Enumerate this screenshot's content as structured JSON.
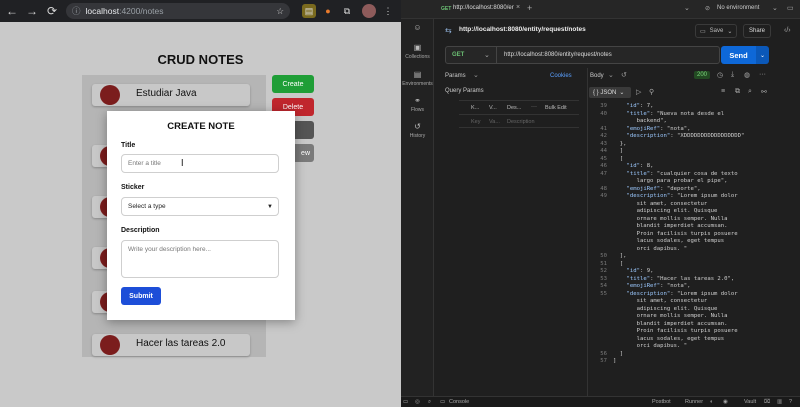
{
  "browser": {
    "url_host": "localhost",
    "url_rest": ":4200/notes"
  },
  "app": {
    "title": "CRUD NOTES",
    "notes": [
      "Estudiar Java",
      "Hacer las tareas 2.0"
    ],
    "side_buttons": [
      {
        "label": "Create",
        "color": "#1f9e37"
      },
      {
        "label": "Delete",
        "color": "#c0262d"
      },
      {
        "label": "",
        "color": "#555"
      },
      {
        "label": "ew",
        "color": "#7a7a7a"
      }
    ]
  },
  "modal": {
    "heading": "CREATE NOTE",
    "title_label": "Title",
    "title_placeholder": "Enter a title",
    "sticker_label": "Sticker",
    "sticker_value": "Select a type",
    "description_label": "Description",
    "description_placeholder": "Write your description here...",
    "submit_label": "Submit"
  },
  "postman": {
    "tab_method": "GET",
    "tab_title": "http://localhost:8080/er",
    "environment": "No environment",
    "request_title": "http://localhost:8080/entity/request/notes",
    "save_label": "Save",
    "share_label": "Share",
    "method": "GET",
    "url": "http://localhost:8080/entity/request/notes",
    "send_label": "Send",
    "rail": [
      "Collections",
      "Environments",
      "Flows",
      "History"
    ],
    "req_tabs": {
      "params": "Params",
      "cookies": "Cookies"
    },
    "query_params_label": "Query Params",
    "params_headers": [
      "K...",
      "V...",
      "Des...",
      "Bulk Edit"
    ],
    "params_placeholders": [
      "Key",
      "Va...",
      "Description"
    ],
    "body_label": "Body",
    "status_code": "200",
    "format_label": "{ } JSON",
    "code_lines": [
      {
        "n": "39",
        "t": "    \"id\": 7,"
      },
      {
        "n": "40",
        "t": "    \"title\": \"Nueva nota desde el\n       backend\","
      },
      {
        "n": "41",
        "t": "    \"emojiRef\": \"nota\","
      },
      {
        "n": "42",
        "t": "    \"description\": \"XDDDDDDDDDDDDDDDDD\""
      },
      {
        "n": "43",
        "t": "  },"
      },
      {
        "n": "44",
        "t": "  ]"
      },
      {
        "n": "45",
        "t": "  ["
      },
      {
        "n": "46",
        "t": "    \"id\": 8,"
      },
      {
        "n": "47",
        "t": "    \"title\": \"cualquier cosa de texto\n       largo para probar el pipe\","
      },
      {
        "n": "48",
        "t": "    \"emojiRef\": \"deporte\","
      },
      {
        "n": "49",
        "t": "    \"description\": \"Lorem ipsum dolor\n       sit amet, consectetur\n       adipiscing elit. Quisque\n       ornare mollis semper. Nulla\n       blandit imperdiet accumsan.\n       Proin facilisis turpis posuere\n       lacus sodales, eget tempus\n       orci dapibus. \""
      },
      {
        "n": "50",
        "t": "  ],"
      },
      {
        "n": "51",
        "t": "  ["
      },
      {
        "n": "52",
        "t": "    \"id\": 9,"
      },
      {
        "n": "53",
        "t": "    \"title\": \"Hacer las tareas 2.0\","
      },
      {
        "n": "54",
        "t": "    \"emojiRef\": \"nota\","
      },
      {
        "n": "55",
        "t": "    \"description\": \"Lorem ipsum dolor\n       sit amet, consectetur\n       adipiscing elit. Quisque\n       ornare mollis semper. Nulla\n       blandit imperdiet accumsan.\n       Proin facilisis turpis posuere\n       lacus sodales, eget tempus\n       orci dapibus. \""
      },
      {
        "n": "56",
        "t": "  ]"
      },
      {
        "n": "57",
        "t": "]"
      }
    ],
    "statusbar": {
      "console": "Console",
      "postbot": "Postbot",
      "runner": "Runner",
      "vault": "Vault"
    }
  }
}
